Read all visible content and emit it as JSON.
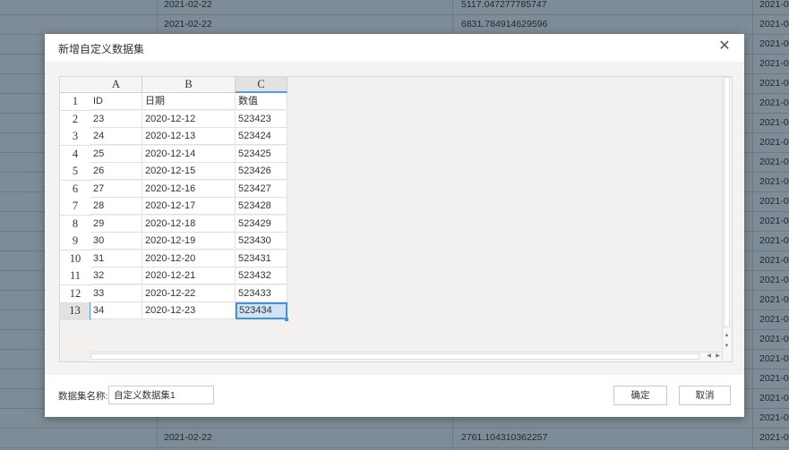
{
  "background": {
    "rows": [
      {
        "c1": "2021-02-22",
        "c2": "5117.047277785747",
        "c3": "2021-0"
      },
      {
        "c1": "2021-02-22",
        "c2": "6831.784914629596",
        "c3": "2021-0"
      },
      {
        "c1": "",
        "c2": "",
        "c3": "2021-0"
      },
      {
        "c1": "",
        "c2": "",
        "c3": "2021-0"
      },
      {
        "c1": "",
        "c2": "",
        "c3": "2021-0"
      },
      {
        "c1": "",
        "c2": "",
        "c3": "2021-0"
      },
      {
        "c1": "",
        "c2": "",
        "c3": "2021-0"
      },
      {
        "c1": "",
        "c2": "",
        "c3": "2021-0"
      },
      {
        "c1": "",
        "c2": "",
        "c3": "2021-0"
      },
      {
        "c1": "",
        "c2": "",
        "c3": "2021-0"
      },
      {
        "c1": "",
        "c2": "",
        "c3": "2021-0"
      },
      {
        "c1": "",
        "c2": "",
        "c3": "2021-0"
      },
      {
        "c1": "",
        "c2": "",
        "c3": "2021-0"
      },
      {
        "c1": "",
        "c2": "",
        "c3": "2021-0"
      },
      {
        "c1": "",
        "c2": "",
        "c3": "2021-0"
      },
      {
        "c1": "",
        "c2": "",
        "c3": "2021-0"
      },
      {
        "c1": "",
        "c2": "",
        "c3": "2021-0"
      },
      {
        "c1": "",
        "c2": "",
        "c3": "2021-0"
      },
      {
        "c1": "",
        "c2": "",
        "c3": "2021-0"
      },
      {
        "c1": "",
        "c2": "",
        "c3": "2021-0"
      },
      {
        "c1": "",
        "c2": "",
        "c3": "2021-0"
      },
      {
        "c1": "",
        "c2": "",
        "c3": "2021-0"
      },
      {
        "c1": "2021-02-22",
        "c2": "2761.104310362257",
        "c3": "2021-0"
      }
    ]
  },
  "dialog": {
    "title": "新增自定义数据集",
    "close_icon": "close-icon",
    "columns": [
      "A",
      "B",
      "C"
    ],
    "rows": [
      {
        "num": "1",
        "a": "ID",
        "b": "日期",
        "c": "数值"
      },
      {
        "num": "2",
        "a": "23",
        "b": "2020-12-12",
        "c": "523423"
      },
      {
        "num": "3",
        "a": "24",
        "b": "2020-12-13",
        "c": "523424"
      },
      {
        "num": "4",
        "a": "25",
        "b": "2020-12-14",
        "c": "523425"
      },
      {
        "num": "5",
        "a": "26",
        "b": "2020-12-15",
        "c": "523426"
      },
      {
        "num": "6",
        "a": "27",
        "b": "2020-12-16",
        "c": "523427"
      },
      {
        "num": "7",
        "a": "28",
        "b": "2020-12-17",
        "c": "523428"
      },
      {
        "num": "8",
        "a": "29",
        "b": "2020-12-18",
        "c": "523429"
      },
      {
        "num": "9",
        "a": "30",
        "b": "2020-12-19",
        "c": "523430"
      },
      {
        "num": "10",
        "a": "31",
        "b": "2020-12-20",
        "c": "523431"
      },
      {
        "num": "11",
        "a": "32",
        "b": "2020-12-21",
        "c": "523432"
      },
      {
        "num": "12",
        "a": "33",
        "b": "2020-12-22",
        "c": "523433"
      },
      {
        "num": "13",
        "a": "34",
        "b": "2020-12-23",
        "c": "523434"
      }
    ],
    "name_label": "数据集名称:",
    "name_value": "自定义数据集1",
    "ok_label": "确定",
    "cancel_label": "取消"
  }
}
